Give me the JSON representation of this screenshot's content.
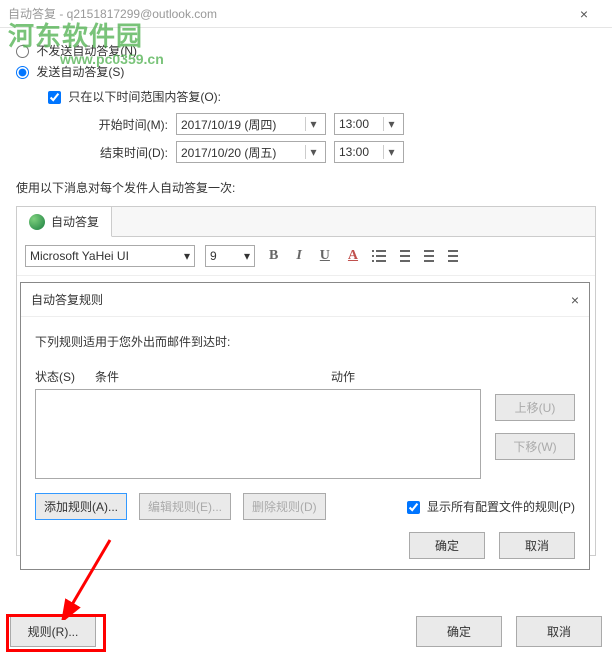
{
  "window": {
    "title": "自动答复 - q2151817299@outlook.com"
  },
  "watermark": {
    "main": "河东软件园",
    "sub": "www.pc0359.cn"
  },
  "radios": {
    "no_send": "不发送自动答复(N)",
    "send": "发送自动答复(S)"
  },
  "time_range": {
    "checkbox": "只在以下时间范围内答复(O):",
    "start_label": "开始时间(M):",
    "start_date": "2017/10/19 (周四)",
    "start_time": "13:00",
    "end_label": "结束时间(D):",
    "end_date": "2017/10/20 (周五)",
    "end_time": "13:00"
  },
  "instruction": "使用以下消息对每个发件人自动答复一次:",
  "tab": {
    "label": "自动答复"
  },
  "toolbar": {
    "font": "Microsoft YaHei UI",
    "size": "9",
    "bold": "B",
    "italic": "I",
    "underline": "U",
    "color": "A"
  },
  "rules": {
    "title": "自动答复规则",
    "subtitle": "下列规则适用于您外出而邮件到达时:",
    "col_status": "状态(S)",
    "col_condition": "条件",
    "col_action": "动作",
    "move_up": "上移(U)",
    "move_down": "下移(W)",
    "add": "添加规则(A)...",
    "edit": "编辑规则(E)...",
    "delete": "删除规则(D)",
    "show_all": "显示所有配置文件的规则(P)",
    "ok": "确定",
    "cancel": "取消"
  },
  "footer": {
    "rules_btn": "规则(R)...",
    "ok": "确定",
    "cancel": "取消"
  }
}
